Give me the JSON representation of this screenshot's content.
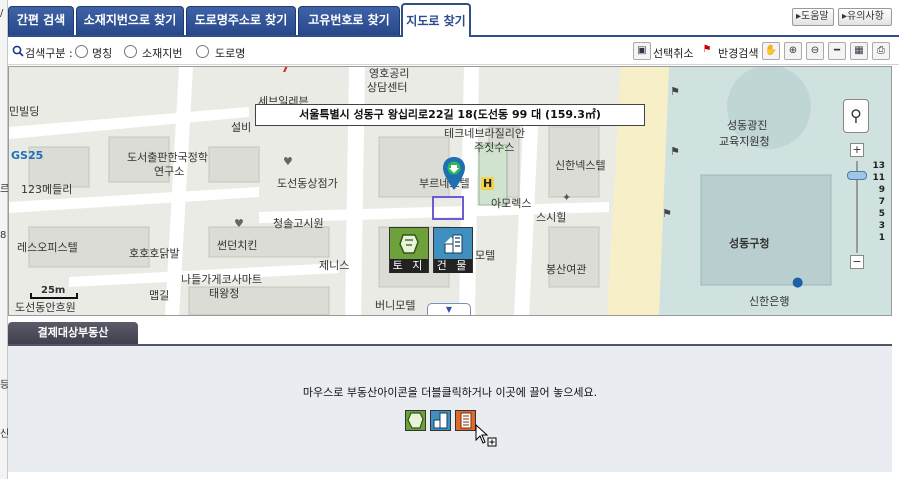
{
  "tabs": [
    {
      "label": "간편 검색"
    },
    {
      "label": "소재지번으로 찾기"
    },
    {
      "label": "도로명주소로 찾기"
    },
    {
      "label": "고유번호로 찾기"
    },
    {
      "label": "지도로 찾기",
      "active": true
    }
  ],
  "top_buttons": {
    "help": "도움말",
    "notice": "유의사항"
  },
  "search": {
    "label": "검색구분 :",
    "options": [
      "명칭",
      "소재지번",
      "도로명"
    ],
    "tools": {
      "deselect": "선택취소",
      "radius": "반경검색"
    }
  },
  "map": {
    "address": "서울특별시 성동구 왕십리로22길 18(도선동 99 대 (159.3㎡)",
    "labels": {
      "l1": "영호공리",
      "l2": "상담센터",
      "l3": "세브일레븐",
      "l4": "설비",
      "l5": "테크네브라질리안",
      "l6": "주짓수스",
      "l7": "신한넥스텔",
      "l8": "성동광진",
      "l9": "교육지원청",
      "l10": "민빌딩",
      "l11": "도서출판한국정학",
      "l12": "연구소",
      "l13": "GS25",
      "l14": "123메들리",
      "l15": "도선동상점가",
      "l16": "부르네모텔",
      "l17": "아모렉스",
      "l18": "스시힐",
      "l19": "청솔고시원",
      "l20": "성동구청",
      "l21": "레스오피스텔",
      "l22": "호호호닭발",
      "l23": "썬던치킨",
      "l24": "모텔",
      "l25": "봉산여관",
      "l26": "제니스",
      "l27": "나들가게코사마트",
      "l28": "태왕정",
      "l29": "버니모텔",
      "l30": "맵길",
      "l31": "신한은행",
      "l32": "도선동안흐원"
    },
    "scale": "25m",
    "land_button": "토 지",
    "building_button": "건 물",
    "zoom_levels": [
      "13",
      "11",
      "9",
      "7",
      "5",
      "3",
      "1"
    ]
  },
  "bottom": {
    "tab_label": "결제대상부동산",
    "drop_message": "마우스로 부동산아이콘을 더블클릭하거나 이곳에 끌어 놓으세요."
  },
  "colors": {
    "tab_blue": "#2f4e8a",
    "bottom_tab": "#4a4a58",
    "drop_bg": "#e9edf1",
    "land_green": "#6ea03c",
    "building_blue": "#3f8fc0",
    "selection": "#6b5bd6"
  },
  "icons": {
    "search": "magnifier-icon",
    "land": "land-icon",
    "building": "building-icon",
    "apartment": "apartment-icon",
    "cursor": "copy-cursor-icon"
  }
}
